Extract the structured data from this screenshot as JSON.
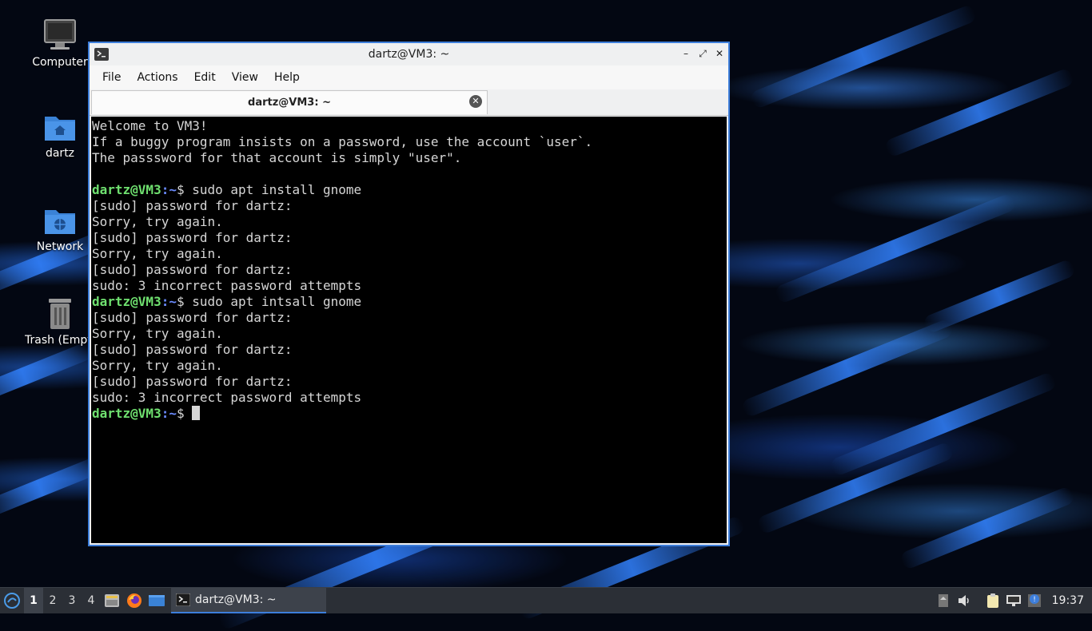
{
  "desktop": {
    "icons": [
      {
        "label": "Computer"
      },
      {
        "label": "dartz"
      },
      {
        "label": "Network"
      },
      {
        "label": "Trash (Empty)"
      }
    ]
  },
  "window": {
    "title": "dartz@VM3: ~",
    "menu": [
      "File",
      "Actions",
      "Edit",
      "View",
      "Help"
    ],
    "tab_label": "dartz@VM3: ~",
    "minimize": "–",
    "maximize": "⤢",
    "close": "✕"
  },
  "terminal": {
    "prompt_user": "dartz@VM3",
    "prompt_path": ":~",
    "prompt_symbol": "$ ",
    "welcome": [
      "Welcome to VM3!",
      "If a buggy program insists on a password, use the account `user`.",
      "The passsword for that account is simply \"user\"."
    ],
    "cmd1": "sudo apt install gnome",
    "cmd2": "sudo apt intsall gnome",
    "block1": [
      "[sudo] password for dartz:",
      "Sorry, try again.",
      "[sudo] password for dartz:",
      "Sorry, try again.",
      "[sudo] password for dartz:",
      "sudo: 3 incorrect password attempts"
    ],
    "block2": [
      "[sudo] password for dartz:",
      "Sorry, try again.",
      "[sudo] password for dartz:",
      "Sorry, try again.",
      "[sudo] password for dartz:",
      "sudo: 3 incorrect password attempts"
    ]
  },
  "taskbar": {
    "workspaces": [
      "1",
      "2",
      "3",
      "4"
    ],
    "task_label": "dartz@VM3: ~",
    "clock": "19:37"
  },
  "colors": {
    "accent": "#3d7edb",
    "prompt_user": "#6fe06f",
    "prompt_path": "#6b8cff"
  }
}
